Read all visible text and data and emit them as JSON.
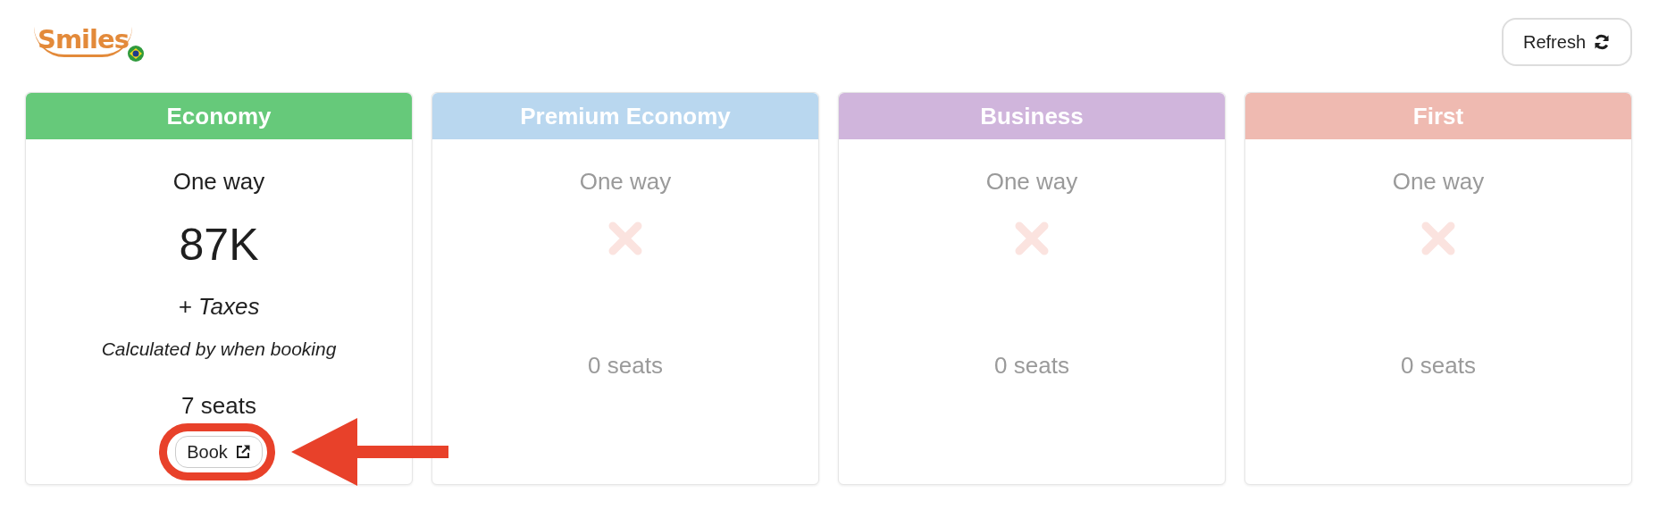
{
  "header": {
    "logo": "Smiles",
    "refresh_button": "Refresh"
  },
  "cabins": [
    {
      "title": "Economy",
      "color": "#66c97a",
      "kind": "available",
      "trip": "One way",
      "price": "87K",
      "taxes": "+ Taxes",
      "note": "Calculated by when booking",
      "seats": "7 seats",
      "button": "Book",
      "highlighted": true
    },
    {
      "title": "Premium Economy",
      "color": "#b9d7ef",
      "kind": "unavailable",
      "trip": "One way",
      "seats": "0 seats"
    },
    {
      "title": "Business",
      "color": "#d0b5dc",
      "kind": "unavailable",
      "trip": "One way",
      "seats": "0 seats"
    },
    {
      "title": "First",
      "color": "#efbab1",
      "kind": "unavailable",
      "trip": "One way",
      "seats": "0 seats"
    }
  ]
}
